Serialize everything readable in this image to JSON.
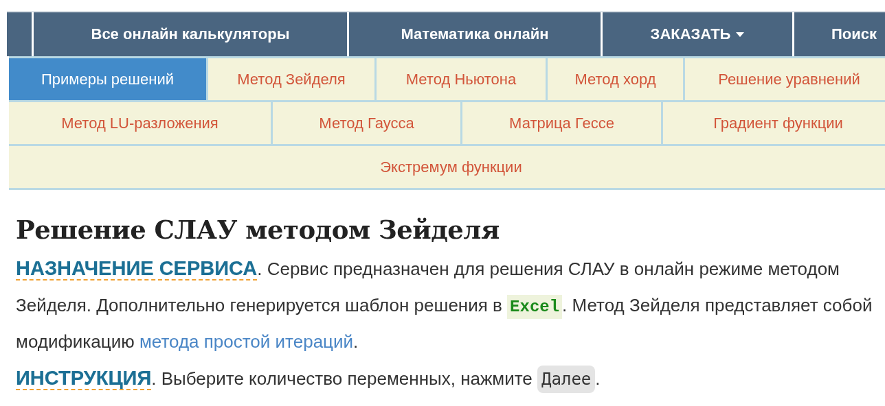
{
  "nav": [
    {
      "label": "Все онлайн калькуляторы",
      "dropdown": false
    },
    {
      "label": "Математика онлайн",
      "dropdown": false
    },
    {
      "label": "ЗАКАЗАТЬ",
      "dropdown": true
    },
    {
      "label": "Поиск",
      "dropdown": false
    }
  ],
  "tab_rows": [
    [
      {
        "label": "Примеры решений",
        "selected": true
      },
      {
        "label": "Метод Зейделя",
        "selected": false
      },
      {
        "label": "Метод Ньютона",
        "selected": false
      },
      {
        "label": "Метод хорд",
        "selected": false
      },
      {
        "label": "Решение уравнений",
        "selected": false
      }
    ],
    [
      {
        "label": "Метод LU-разложения",
        "selected": false
      },
      {
        "label": "Метод Гаусса",
        "selected": false
      },
      {
        "label": "Матрица Гессе",
        "selected": false
      },
      {
        "label": "Градиент функции",
        "selected": false
      }
    ],
    [
      {
        "label": "Экстремум функции",
        "selected": false
      }
    ]
  ],
  "title": "Решение СЛАУ методом Зейделя",
  "paragraphs": [
    [
      {
        "kind": "term",
        "text": "НАЗНАЧЕНИЕ СЕРВИСА"
      },
      {
        "kind": "text",
        "text": ". Сервис предназначен для решения СЛАУ в онлайн режиме методом Зейделя. Дополнительно генерируется шаблон решения в "
      },
      {
        "kind": "code",
        "text": "Excel"
      },
      {
        "kind": "text",
        "text": ". Метод Зейделя представляет собой модификацию "
      },
      {
        "kind": "link",
        "text": "метода простой итераций"
      },
      {
        "kind": "text",
        "text": "."
      }
    ],
    [
      {
        "kind": "term",
        "text": "ИНСТРУКЦИЯ"
      },
      {
        "kind": "text",
        "text": ". Выберите количество переменных, нажмите "
      },
      {
        "kind": "key",
        "text": "Далее"
      },
      {
        "kind": "text",
        "text": "."
      }
    ]
  ]
}
